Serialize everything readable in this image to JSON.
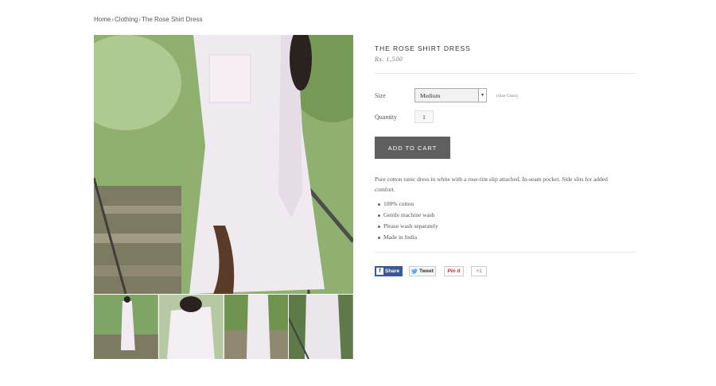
{
  "breadcrumb": {
    "home": "Home",
    "category": "Clothing",
    "current": "The Rose Shirt Dress",
    "separator": "›"
  },
  "product": {
    "title": "THE ROSE SHIRT DRESS",
    "price": "Rs. 1,500",
    "size_label": "Size",
    "size_value": "Medium",
    "size_chart": "(Size Chart)",
    "quantity_label": "Quantity",
    "quantity_value": "1",
    "add_to_cart": "ADD TO CART",
    "description": "Pure cotton tunic dress in white with a rose-tint slip attached. In-seam pocket. Side slits for added comfort.",
    "features": [
      "100% cotton",
      "Gentle machine wash",
      "Please wash separately",
      "Made in India"
    ]
  },
  "social": {
    "facebook": "Share",
    "twitter": "Tweet",
    "pinterest": "Pin it",
    "gplus": "+1"
  },
  "icons": {
    "select_arrow": "caret-down-icon",
    "facebook": "facebook-icon",
    "twitter": "twitter-bird-icon",
    "gplus": "gplus-icon"
  }
}
